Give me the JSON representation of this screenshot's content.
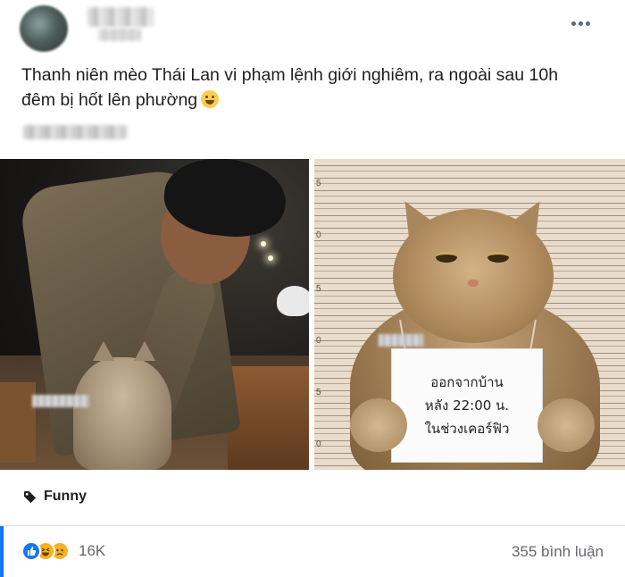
{
  "post": {
    "caption": "Thanh niên mèo Thái Lan vi phạm lệnh giới nghiêm, ra ngoài sau 10h đêm bị hốt lên phường",
    "caption_emoji": "grinning-sweat-emoji"
  },
  "photo_right": {
    "ruler_labels": [
      "5",
      "0",
      "5",
      "0",
      "5",
      "0"
    ],
    "sign_lines": [
      "ออกจากบ้าน",
      "หลัง 22:00 น.",
      "ในช่วงเคอร์ฟิว"
    ]
  },
  "tag": {
    "label": "Funny",
    "icon": "tag-icon"
  },
  "engagement": {
    "reaction_icons": [
      "like-icon",
      "haha-icon",
      "sad-icon"
    ],
    "reaction_count": "16K",
    "comments_label": "355 bình luận"
  },
  "colors": {
    "accent": "#1877f2",
    "secondary_text": "#65676b"
  }
}
